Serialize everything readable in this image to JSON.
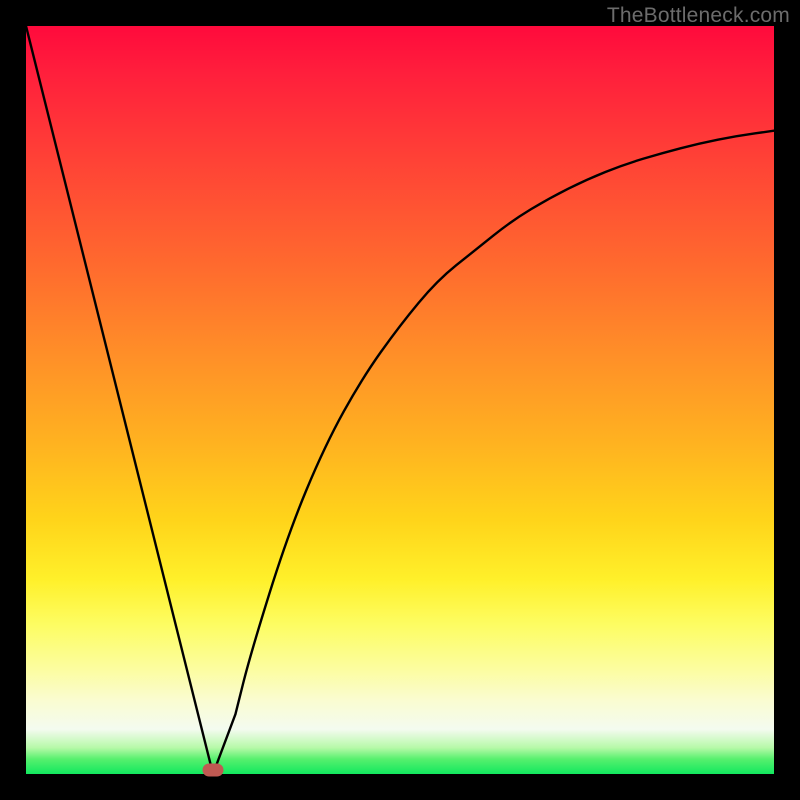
{
  "watermark": "TheBottleneck.com",
  "colors": {
    "frame": "#000000",
    "curve_stroke": "#000000",
    "marker": "#c05952"
  },
  "chart_data": {
    "type": "line",
    "title": "",
    "xlabel": "",
    "ylabel": "",
    "xlim": [
      0,
      100
    ],
    "ylim": [
      0,
      100
    ],
    "grid": false,
    "legend": false,
    "annotations": [
      "TheBottleneck.com"
    ],
    "description": "V-shaped bottleneck curve: steep linear descent from top-left to a minimum near x≈25, then a concave ascent approaching ~86 at x=100. Background gradient encodes value (red=high, green=low).",
    "series": [
      {
        "name": "bottleneck-curve",
        "x": [
          0,
          5,
          10,
          15,
          20,
          25,
          28,
          30,
          35,
          40,
          45,
          50,
          55,
          60,
          65,
          70,
          75,
          80,
          85,
          90,
          95,
          100
        ],
        "y": [
          100,
          80,
          60,
          40,
          20,
          0,
          8,
          16,
          32,
          44,
          53,
          60,
          66,
          70,
          74,
          77,
          79.5,
          81.5,
          83,
          84.3,
          85.3,
          86
        ]
      }
    ],
    "marker": {
      "x": 25,
      "y": 0
    },
    "gradient_stops": [
      {
        "pos": 0,
        "color": "#ff0a3c"
      },
      {
        "pos": 50,
        "color": "#ffb320"
      },
      {
        "pos": 80,
        "color": "#fdfd62"
      },
      {
        "pos": 100,
        "color": "#12e85f"
      }
    ]
  }
}
